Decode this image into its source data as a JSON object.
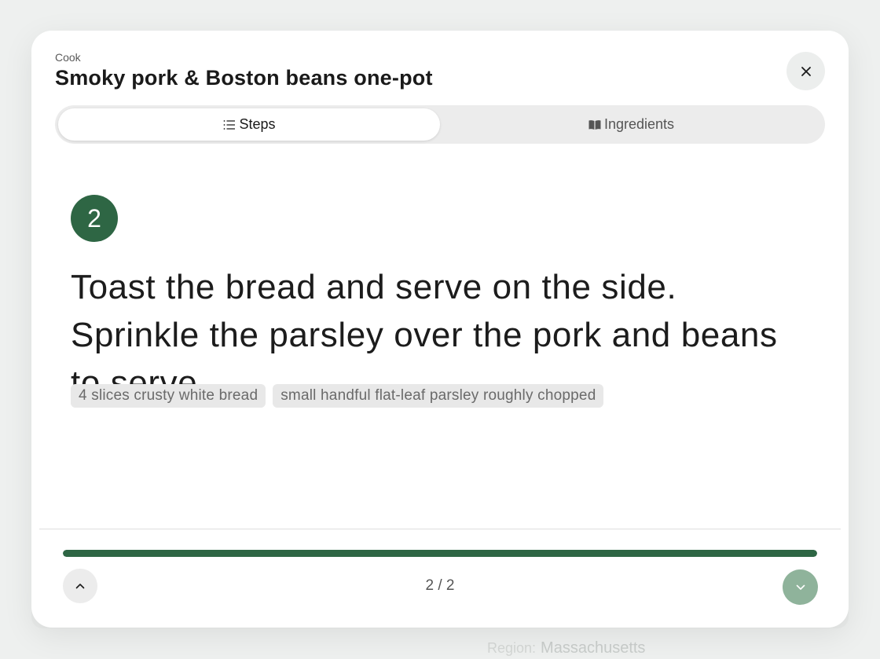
{
  "background": {
    "region_label": "Region:",
    "region_value": "Massachusetts"
  },
  "header": {
    "eyebrow": "Cook",
    "title": "Smoky pork & Boston beans one-pot",
    "close_icon": "close-icon"
  },
  "tabs": [
    {
      "label": "Steps",
      "icon": "list-icon",
      "active": true
    },
    {
      "label": "Ingredients",
      "icon": "book-icon",
      "active": false
    }
  ],
  "step": {
    "number": "2",
    "text": "Toast the bread and serve on the side. Sprinkle the parsley over the pork and beans to serve.",
    "ingredients": [
      "4 slices crusty white bread",
      "small handful flat-leaf parsley roughly chopped"
    ]
  },
  "footer": {
    "progress": 1.0,
    "counter": "2 / 2",
    "prev_icon": "chevron-up-icon",
    "next_icon": "chevron-down-icon"
  },
  "colors": {
    "accent": "#2e6644",
    "accent_light": "#8fb39b",
    "chip_bg": "#e8e8e8",
    "tab_track": "#ececec"
  }
}
